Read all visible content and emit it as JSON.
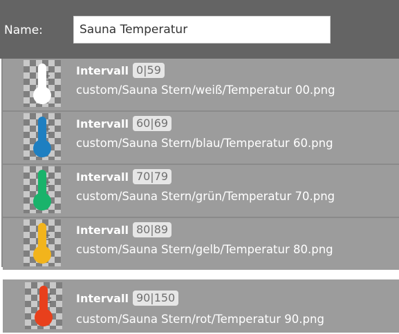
{
  "header": {
    "name_label": "Name:",
    "name_value": "Sauna Temperatur"
  },
  "rows": [
    {
      "title": "Intervall",
      "range": "0|59",
      "path": "custom/Sauna Stern/weiß/Temperatur 00.png",
      "icon": "thermometer-icon",
      "color": "#ffffff"
    },
    {
      "title": "Intervall",
      "range": "60|69",
      "path": "custom/Sauna Stern/blau/Temperatur 60.png",
      "icon": "thermometer-icon",
      "color": "#1e7fc1"
    },
    {
      "title": "Intervall",
      "range": "70|79",
      "path": "custom/Sauna Stern/grün/Temperatur 70.png",
      "icon": "thermometer-icon",
      "color": "#19b36b"
    },
    {
      "title": "Intervall",
      "range": "80|89",
      "path": "custom/Sauna Stern/gelb/Temperatur 80.png",
      "icon": "thermometer-icon",
      "color": "#f2b41c"
    },
    {
      "title": "Intervall",
      "range": "90|150",
      "path": "custom/Sauna Stern/rot/Temperatur 90.png",
      "icon": "thermometer-icon",
      "color": "#e8401c"
    }
  ]
}
